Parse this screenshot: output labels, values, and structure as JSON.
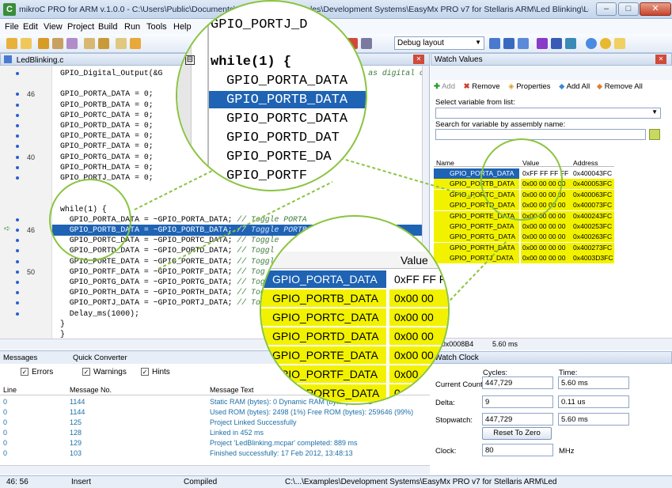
{
  "window": {
    "title": "mikroC PRO for ARM v.1.0.0 - C:\\Users\\Public\\Documents\\M... for ARM\\Examples\\Development Systems\\EasyMx PRO v7 for Stellaris ARM\\Led Blinking\\LedBlinkin...",
    "app_icon": "C",
    "minimize": "–",
    "maximize": "□",
    "close": "✕"
  },
  "menu": [
    "File",
    "Edit",
    "View",
    "Project",
    "Build",
    "Run",
    "Tools",
    "Help"
  ],
  "toolbar": {
    "debug_layout": "Debug layout"
  },
  "editor": {
    "tab_label": "LedBlinking.c",
    "gutter_numbers": [
      "46",
      "40",
      "46",
      "50"
    ],
    "lines": [
      "GPIO_Digital_Output(&G",
      "",
      "GPIO_PORTA_DATA = 0;",
      "GPIO_PORTB_DATA = 0;",
      "GPIO_PORTC_DATA = 0;",
      "GPIO_PORTD_DATA = 0;",
      "GPIO_PORTE_DATA = 0;",
      "GPIO_PORTF_DATA = 0;",
      "GPIO_PORTG_DATA = 0;",
      "GPIO_PORTH_DATA = 0;",
      "GPIO_PORTJ_DATA = 0;",
      "",
      "",
      "while(1) {",
      "  GPIO_PORTA_DATA = ~GPIO_PORTA_DATA;",
      "  GPIO_PORTB_DATA = ~GPIO_PORTB_DATA;",
      "  GPIO_PORTC_DATA = ~GPIO_PORTC_DATA;",
      "  GPIO_PORTD_DATA = ~GPIO_PORTD_DATA;",
      "  GPIO_PORTE_DATA = ~GPIO_PORTE_DATA;",
      "  GPIO_PORTF_DATA = ~GPIO_PORTF_DATA;",
      "  GPIO_PORTG_DATA = ~GPIO_PORTG_DATA;",
      "  GPIO_PORTH_DATA = ~GPIO_PORTH_DATA;",
      "  GPIO_PORTJ_DATA = ~GPIO_PORTJ_DATA;",
      "  Delay_ms(1000);",
      "}",
      "}"
    ],
    "comments": [
      "// Toggle PORTA",
      "// Toggle PORTB",
      "// Toggle",
      "// Toggl",
      "// Toggl",
      "// Tog",
      "// Tog",
      "// Tog",
      "// To"
    ],
    "top_comment": "PORTJ as digital c"
  },
  "watch_values": {
    "title": "Watch Values",
    "add": "Add",
    "remove": "Remove",
    "properties": "Properties",
    "add_all": "Add All",
    "remove_all": "Remove All",
    "select_label": "Select variable from list:",
    "search_label": "Search for variable by assembly name:",
    "col_name": "Name",
    "col_value": "Value",
    "col_address": "Address",
    "rows": [
      {
        "name": "GPIO_PORTA_DATA",
        "value": "0xFF FF FF FF",
        "address": "0x400043FC"
      },
      {
        "name": "GPIO_PORTB_DATA",
        "value": "0x00 00 00 00",
        "address": "0x400053FC"
      },
      {
        "name": "GPIO_PORTC_DATA",
        "value": "0x00 00 00 00",
        "address": "0x400063FC"
      },
      {
        "name": "GPIO_PORTD_DATA",
        "value": "0x00 00 00 00",
        "address": "0x400073FC"
      },
      {
        "name": "GPIO_PORTE_DATA",
        "value": "0x00 00 00 00",
        "address": "0x400243FC"
      },
      {
        "name": "GPIO_PORTF_DATA",
        "value": "0x00 00 00 00",
        "address": "0x400253FC"
      },
      {
        "name": "GPIO_PORTG_DATA",
        "value": "0x00 00 00 00",
        "address": "0x400263FC"
      },
      {
        "name": "GPIO_PORTH_DATA",
        "value": "0x00 00 00 00",
        "address": "0x400273FC"
      },
      {
        "name": "GPIO_PORTJ_DATA",
        "value": "0x00 00 00 00",
        "address": "0x4003D3FC"
      }
    ],
    "footer_addr": "= 0x0008B4",
    "footer_time": "5.60 ms"
  },
  "zoom_code": {
    "portj_top": "GPIO_PORTJ_D",
    "while": "while(1) {",
    "lines": [
      "GPIO_PORTA_DATA",
      "GPIO_PORTB_DATA",
      "GPIO_PORTC_DATA",
      "GPIO_PORTD_DAT",
      "GPIO_PORTE_DA",
      "GPIO_PORTF"
    ]
  },
  "zoom_table": {
    "value_header": "Value",
    "rows": [
      {
        "name": "GPIO_PORTA_DATA",
        "value": "0xFF FF F"
      },
      {
        "name": "GPIO_PORTB_DATA",
        "value": "0x00 00"
      },
      {
        "name": "GPIO_PORTC_DATA",
        "value": "0x00 00"
      },
      {
        "name": "GPIO_PORTD_DATA",
        "value": "0x00 00"
      },
      {
        "name": "GPIO_PORTE_DATA",
        "value": "0x00 00"
      },
      {
        "name": "GPIO_PORTF_DATA",
        "value": "0x00"
      },
      {
        "name": "GPIO_PORTG_DATA",
        "value": "0"
      }
    ]
  },
  "messages": {
    "tab_messages": "Messages",
    "tab_quick": "Quick Converter",
    "errors": "Errors",
    "warnings": "Warnings",
    "hints": "Hints",
    "col_line": "Line",
    "col_msgno": "Message No.",
    "col_text": "Message Text",
    "rows": [
      {
        "line": "0",
        "no": "1144",
        "text": "Static RAM (bytes): 0   Dynamic RAM (bytes): 98301"
      },
      {
        "line": "0",
        "no": "1144",
        "text": "Used ROM (bytes): 2498 (1%)  Free ROM (bytes): 259646 (99%)"
      },
      {
        "line": "0",
        "no": "125",
        "text": "Project Linked Successfully"
      },
      {
        "line": "0",
        "no": "128",
        "text": "Linked in 452 ms"
      },
      {
        "line": "0",
        "no": "129",
        "text": "Project 'LedBlinking.mcpar' completed: 889 ms"
      },
      {
        "line": "0",
        "no": "103",
        "text": "Finished successfully: 17 Feb 2012, 13:48:13"
      }
    ]
  },
  "watch_clock": {
    "title": "Watch Clock",
    "cycles_label": "Cycles:",
    "time_label": "Time:",
    "current_count": "Current Count:",
    "current_cycles": "447,729",
    "current_time": "5.60 ms",
    "delta": "Delta:",
    "delta_cycles": "9",
    "delta_time": "0.11 us",
    "stopwatch": "Stopwatch:",
    "stop_cycles": "447,729",
    "stop_time": "5.60 ms",
    "reset": "Reset To Zero",
    "clock": "Clock:",
    "clock_val": "80",
    "clock_unit": "MHz"
  },
  "status": {
    "pos": "46: 56",
    "mode": "Insert",
    "state": "Compiled",
    "path": "C:\\...\\Examples\\Development Systems\\EasyMx PRO v7 for Stellaris ARM\\Led"
  }
}
